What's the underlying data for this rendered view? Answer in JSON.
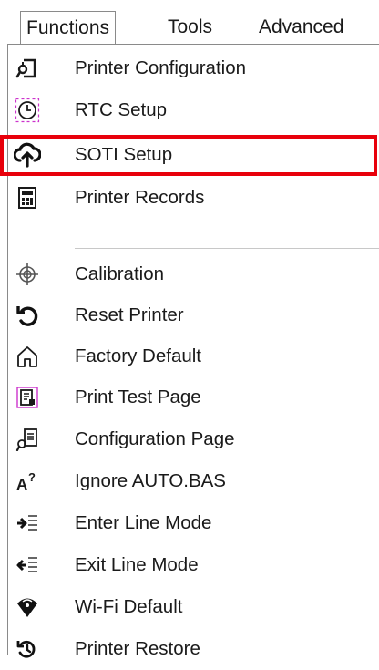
{
  "menubar": {
    "tabs": [
      {
        "label": "Functions"
      },
      {
        "label": "Tools"
      },
      {
        "label": "Advanced"
      }
    ]
  },
  "menu": {
    "items": [
      {
        "label": "Printer Configuration",
        "icon": "printer-config-icon"
      },
      {
        "label": "RTC Setup",
        "icon": "clock-icon"
      },
      {
        "label": "SOTI Setup",
        "icon": "cloud-upload-icon"
      },
      {
        "label": "Printer Records",
        "icon": "records-icon"
      },
      {
        "label": "Calibration",
        "icon": "crosshair-icon"
      },
      {
        "label": "Reset Printer",
        "icon": "reset-icon"
      },
      {
        "label": "Factory Default",
        "icon": "home-icon"
      },
      {
        "label": "Print Test Page",
        "icon": "test-page-icon"
      },
      {
        "label": "Configuration Page",
        "icon": "config-page-icon"
      },
      {
        "label": "Ignore AUTO.BAS",
        "icon": "ignore-auto-icon"
      },
      {
        "label": "Enter Line Mode",
        "icon": "enter-line-mode-icon"
      },
      {
        "label": "Exit Line Mode",
        "icon": "exit-line-mode-icon"
      },
      {
        "label": "Wi-Fi Default",
        "icon": "wifi-shield-icon"
      },
      {
        "label": "Printer Restore",
        "icon": "restore-icon"
      }
    ],
    "highlighted_item": "SOTI Setup",
    "highlight_color": "#e8000b"
  }
}
